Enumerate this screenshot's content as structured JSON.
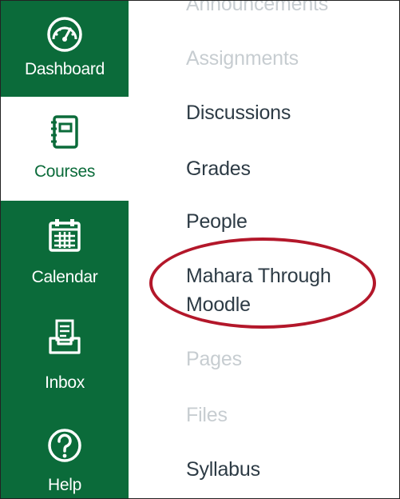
{
  "global_nav": {
    "items": [
      {
        "label": "Dashboard",
        "icon": "dashboard-icon",
        "active": false
      },
      {
        "label": "Courses",
        "icon": "courses-icon",
        "active": true
      },
      {
        "label": "Calendar",
        "icon": "calendar-icon",
        "active": false
      },
      {
        "label": "Inbox",
        "icon": "inbox-icon",
        "active": false
      },
      {
        "label": "Help",
        "icon": "help-icon",
        "active": false
      }
    ]
  },
  "course_nav": {
    "links": [
      {
        "label": "Announcements",
        "state": "disabled"
      },
      {
        "label": "Assignments",
        "state": "disabled"
      },
      {
        "label": "Discussions",
        "state": "enabled"
      },
      {
        "label": "Grades",
        "state": "enabled"
      },
      {
        "label": "People",
        "state": "enabled"
      },
      {
        "label": "Mahara Through Moodle",
        "state": "enabled",
        "highlighted": true
      },
      {
        "label": "Pages",
        "state": "disabled"
      },
      {
        "label": "Files",
        "state": "disabled"
      },
      {
        "label": "Syllabus",
        "state": "enabled"
      }
    ]
  },
  "colors": {
    "nav_bg": "#0b6b3a",
    "link_text": "#2d3b45",
    "disabled_text": "#c7cdd1",
    "highlight_ring": "#b3172a"
  }
}
